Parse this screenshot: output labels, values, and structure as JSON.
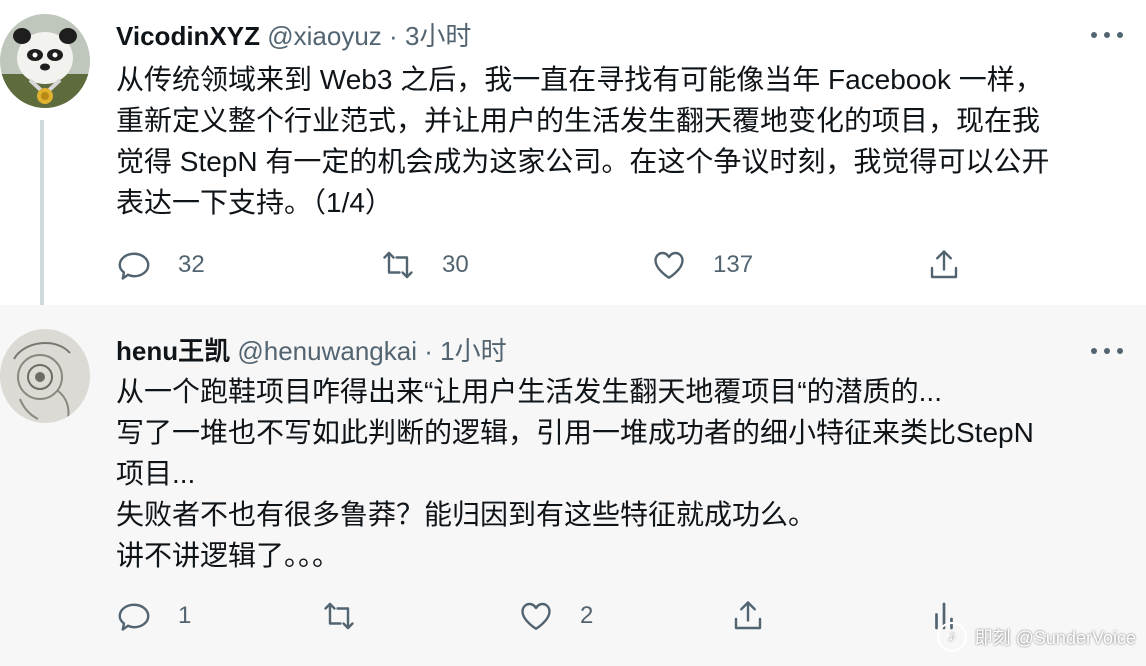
{
  "tweets": [
    {
      "name": "VicodinXYZ",
      "handle": "@xiaoyuz",
      "sep": "·",
      "time": "3小时",
      "lines": [
        "从传统领域来到 Web3 之后，我一直在寻找有可能像当年 Facebook 一样，",
        "重新定义整个行业范式，并让用户的生活发生翻天覆地变化的项目，现在我",
        "觉得 StepN 有一定的机会成为这家公司。在这个争议时刻，我觉得可以公开",
        "表达一下支持。（1/4）"
      ],
      "replies": "32",
      "retweets": "30",
      "likes": "137"
    },
    {
      "name": "henu王凯",
      "handle": "@henuwangkai",
      "sep": "·",
      "time": "1小时",
      "lines": [
        "从一个跑鞋项目咋得出来“让用户生活发生翻天地覆项目“的潜质的...",
        "写了一堆也不写如此判断的逻辑，引用一堆成功者的细小特征来类比StepN",
        "项目...",
        "失败者不也有很多鲁莽？能归因到有这些特征就成功么。",
        "讲不讲逻辑了。。。"
      ],
      "replies": "1",
      "retweets": "",
      "likes": "2"
    }
  ],
  "watermark": {
    "logo": "♪",
    "text": "即刻 @SunderVoice"
  },
  "icons": {
    "reply": "reply-icon",
    "retweet": "retweet-icon",
    "like": "like-icon",
    "share": "share-icon",
    "analytics": "analytics-icon",
    "more": "more-icon"
  },
  "colors": {
    "text": "#0f1419",
    "secondary": "#536471",
    "thread_line": "#cfd9de",
    "reply_bg": "#f7f7f7"
  }
}
